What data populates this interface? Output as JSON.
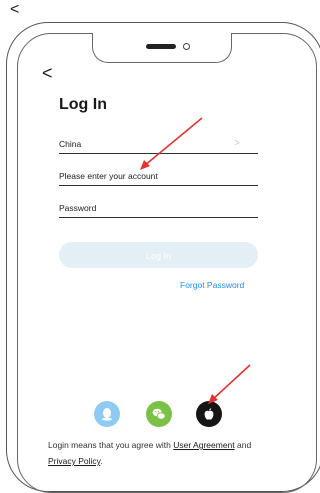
{
  "nav": {
    "outer_back_glyph": "<",
    "inner_back_glyph": "<"
  },
  "login": {
    "title": "Log In",
    "region": "China",
    "region_chevron": ">",
    "account_placeholder": "Please  enter your account",
    "password_placeholder": "Password",
    "login_button": "Log In",
    "forgot_password": "Forgot Password"
  },
  "social": {
    "items": [
      {
        "name": "qq-icon",
        "color": "#8ecaf1"
      },
      {
        "name": "wechat-icon",
        "color": "#7ac146"
      },
      {
        "name": "apple-icon",
        "color": "#161616"
      }
    ]
  },
  "agreement": {
    "prefix": "Login means that you agree with ",
    "user_agreement": "User Agreement",
    "and": " and",
    "privacy_policy": "Privacy Policy",
    "suffix": "."
  },
  "annotations": {
    "arrow_color": "#e23232"
  },
  "colors": {
    "accent": "#2a8be0",
    "button_disabled": "#e4eef5"
  }
}
